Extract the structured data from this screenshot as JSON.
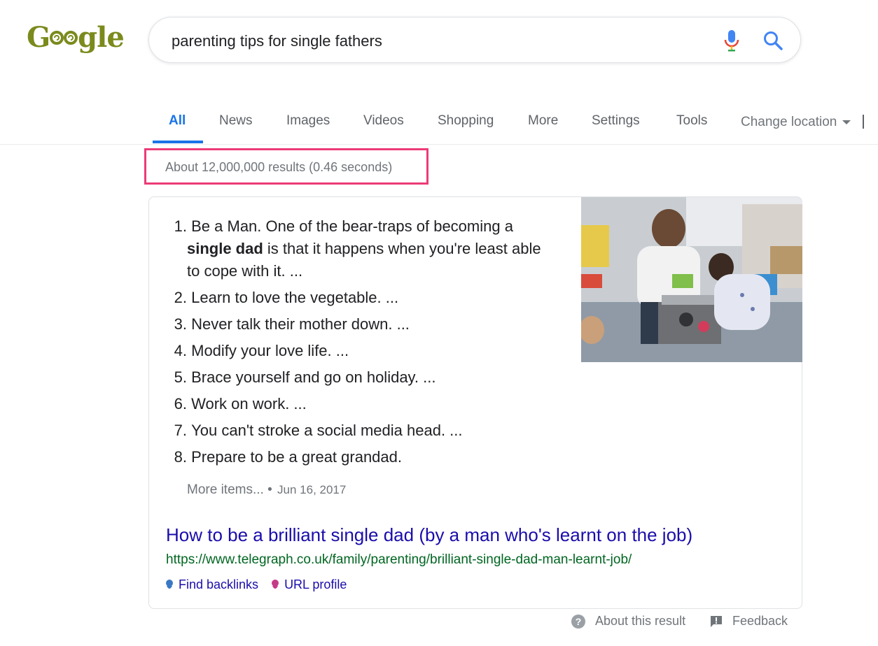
{
  "logo": {
    "text_prefix": "G",
    "text_suffix": "gle",
    "alt": "Google"
  },
  "search": {
    "query": "parenting tips for single fathers"
  },
  "tabs": [
    {
      "label": "All",
      "active": true
    },
    {
      "label": "News"
    },
    {
      "label": "Images"
    },
    {
      "label": "Videos"
    },
    {
      "label": "Shopping"
    },
    {
      "label": "More"
    },
    {
      "label": "Settings"
    },
    {
      "label": "Tools"
    }
  ],
  "change_location": "Change location",
  "result_stats": "About 12,000,000 results (0.46 seconds)",
  "snippet": {
    "items": [
      {
        "num": "1.",
        "pre": "Be a Man. One of the bear-traps of becoming a ",
        "bold": "single dad",
        "post": " is that it happens when you're least able to cope with it. ..."
      },
      {
        "num": "2.",
        "pre": "Learn to love the vegetable. ..."
      },
      {
        "num": "3.",
        "pre": "Never talk their mother down. ..."
      },
      {
        "num": "4.",
        "pre": "Modify your love life. ..."
      },
      {
        "num": "5.",
        "pre": "Brace yourself and go on holiday. ..."
      },
      {
        "num": "6.",
        "pre": "Work on work. ..."
      },
      {
        "num": "7.",
        "pre": "You can't stroke a social media head. ..."
      },
      {
        "num": "8.",
        "pre": "Prepare to be a great grandad."
      }
    ],
    "more_items": "More items...",
    "separator": "•",
    "date": "Jun 16, 2017",
    "title": "How to be a brilliant single dad (by a man who's learnt on the job)",
    "url": "https://www.telegraph.co.uk/family/parenting/brilliant-single-dad-man-learnt-job/",
    "find_backlinks": "Find backlinks",
    "url_profile": "URL profile"
  },
  "footer": {
    "about": "About this result",
    "feedback": "Feedback"
  },
  "colors": {
    "accent": "#1a73e8",
    "link": "#1a0dab",
    "url": "#006621",
    "highlight": "#ec3b78"
  }
}
